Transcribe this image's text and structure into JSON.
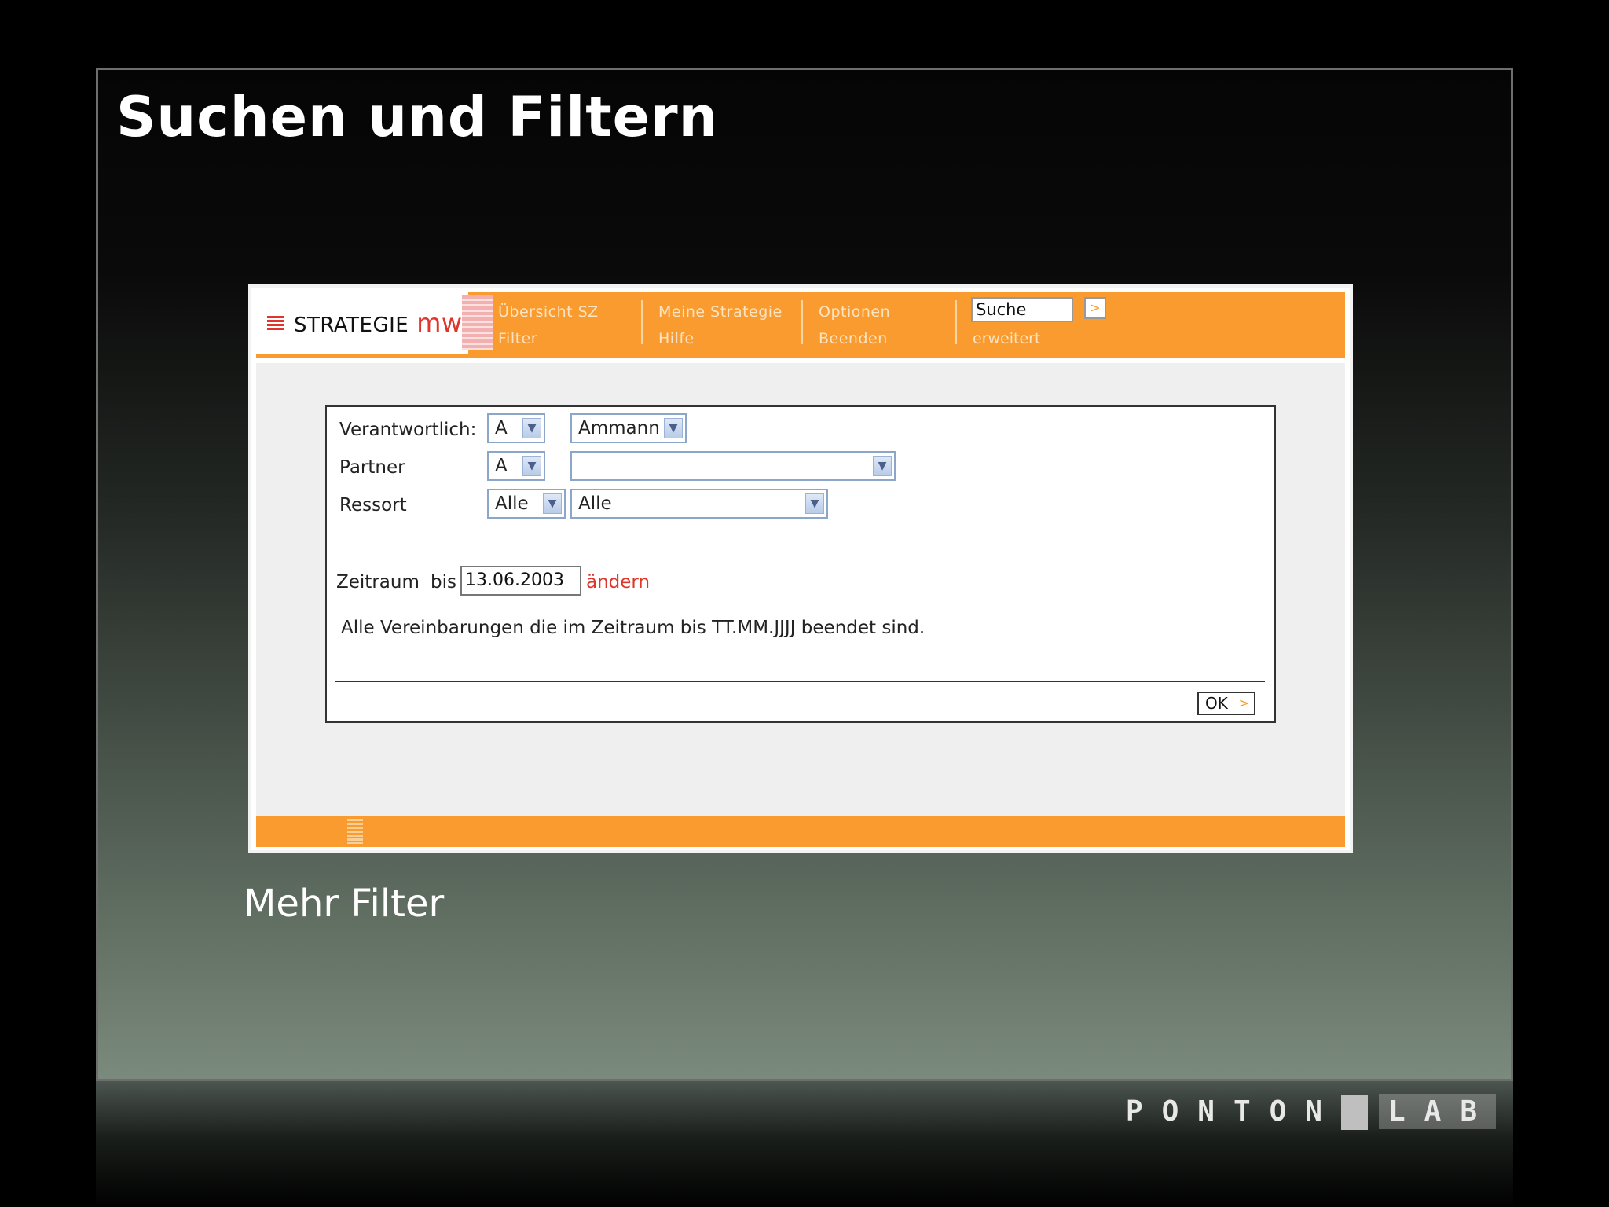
{
  "slide": {
    "title": "Suchen und Filtern",
    "caption": "Mehr Filter",
    "brand": {
      "left": "PONTON",
      "right": "LAB"
    }
  },
  "app": {
    "logo": {
      "text": "STRATEGIE",
      "suffix": "mw"
    },
    "nav": [
      {
        "top": "Übersicht SZ",
        "bottom": "Filter"
      },
      {
        "top": "Meine Strategie",
        "bottom": "Hilfe"
      },
      {
        "top": "Optionen",
        "bottom": "Beenden"
      }
    ],
    "search": {
      "value": "Suche",
      "extended": "erweitert"
    },
    "form": {
      "verantwortlich_label": "Verantwortlich:",
      "verantwortlich_letter": "A",
      "verantwortlich_name": "Ammann",
      "partner_label": "Partner",
      "partner_letter": "A",
      "partner_name": "",
      "ressort_label": "Ressort",
      "ressort_short": "Alle",
      "ressort_long": "Alle",
      "zeitraum_label": "Zeitraum",
      "bis_label": "bis",
      "date_value": "13.06.2003",
      "change_link": "ändern",
      "info_text": "Alle Vereinbarungen die im Zeitraum bis TT.MM.JJJJ beendet sind.",
      "ok_label": "OK"
    }
  },
  "colors": {
    "accent": "#f99b2e",
    "logo_red": "#e0352b"
  }
}
